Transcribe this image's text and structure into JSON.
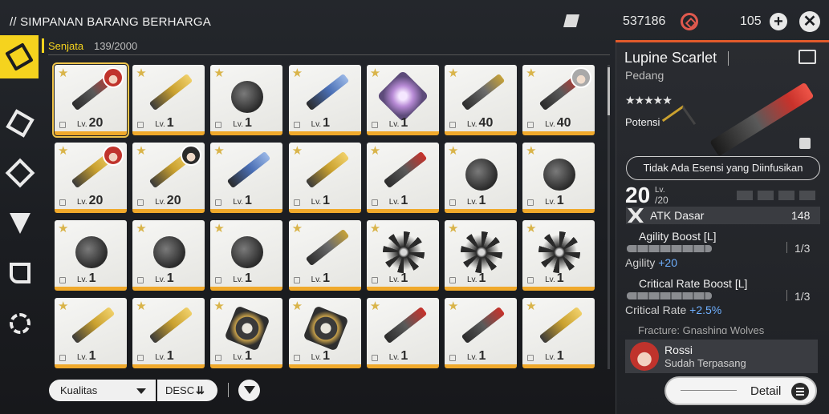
{
  "header": {
    "title": "// SIMPANAN BARANG BERHARGA",
    "currency_primary": "537186",
    "currency_secondary": "105"
  },
  "sidebar": {
    "items": [
      {
        "name": "weapon",
        "active": true
      },
      {
        "name": "echo",
        "active": false
      },
      {
        "name": "supply",
        "active": false
      },
      {
        "name": "resource",
        "active": false
      },
      {
        "name": "quest-item",
        "active": false
      },
      {
        "name": "special",
        "active": false
      }
    ]
  },
  "category": {
    "label": "Senjata",
    "count": "139/2000"
  },
  "inventory": {
    "level_prefix": "Lv.",
    "items": [
      {
        "level": "20",
        "weapon": "sword red",
        "avatar": "rossi",
        "selected": true
      },
      {
        "level": "1",
        "weapon": "pistol gold"
      },
      {
        "level": "1",
        "weapon": "gauntlet"
      },
      {
        "level": "1",
        "weapon": "sword blue"
      },
      {
        "level": "1",
        "weapon": "gem"
      },
      {
        "level": "40",
        "weapon": "sword"
      },
      {
        "level": "40",
        "weapon": "sword red",
        "avatar": "silver"
      },
      {
        "level": "20",
        "weapon": "sword gold",
        "avatar": "rossi"
      },
      {
        "level": "20",
        "weapon": "sword gold",
        "avatar": "dark"
      },
      {
        "level": "1",
        "weapon": "sword blue"
      },
      {
        "level": "1",
        "weapon": "sword gold"
      },
      {
        "level": "1",
        "weapon": "pistol red"
      },
      {
        "level": "1",
        "weapon": "gauntlet"
      },
      {
        "level": "1",
        "weapon": "gauntlet"
      },
      {
        "level": "1",
        "weapon": "gauntlet"
      },
      {
        "level": "1",
        "weapon": "gauntlet"
      },
      {
        "level": "1",
        "weapon": "gauntlet"
      },
      {
        "level": "1",
        "weapon": "sword"
      },
      {
        "level": "1",
        "weapon": "star-blade"
      },
      {
        "level": "1",
        "weapon": "star-blade"
      },
      {
        "level": "1",
        "weapon": "star-blade"
      },
      {
        "level": "1",
        "weapon": "sword gold"
      },
      {
        "level": "1",
        "weapon": "sword gold"
      },
      {
        "level": "1",
        "weapon": "gear"
      },
      {
        "level": "1",
        "weapon": "gear"
      },
      {
        "level": "1",
        "weapon": "sword red"
      },
      {
        "level": "1",
        "weapon": "sword red"
      },
      {
        "level": "1",
        "weapon": "sword gold"
      }
    ]
  },
  "controls": {
    "sort_label": "Kualitas",
    "order_label": "DESC"
  },
  "detail": {
    "name": "Lupine Scarlet",
    "type": "Pedang",
    "stars": "★★★★★",
    "potensi_label": "Potensi",
    "esensi_button": "Tidak Ada Esensi yang Diinfusikan",
    "level": "20",
    "level_label": "Lv.",
    "level_max": "/20",
    "atk_label": "ATK Dasar",
    "atk_value": "148",
    "skills": [
      {
        "title": "Agility Boost [L]",
        "count": "1/3",
        "stat": "Agility",
        "value": "+20"
      },
      {
        "title": "Critical Rate Boost [L]",
        "count": "1/3",
        "stat": "Critical Rate",
        "value": "+2.5%"
      }
    ],
    "fracture": "Fracture: Gnashing Wolves",
    "equipped_name": "Rossi",
    "equipped_status": "Sudah Terpasang",
    "detail_button": "Detail"
  }
}
